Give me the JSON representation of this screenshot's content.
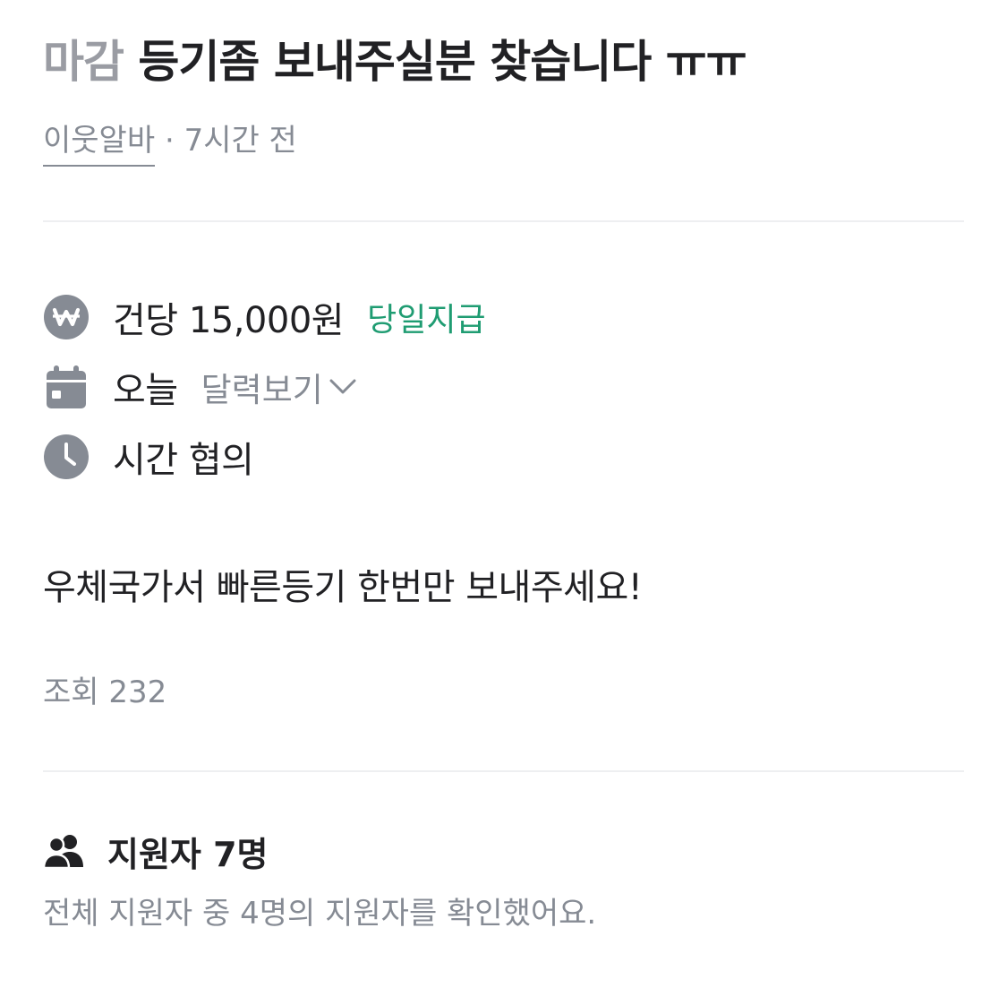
{
  "post": {
    "status": "마감",
    "title": "등기좀 보내주실분 찾습니다 ㅠㅠ",
    "author": "이웃알바",
    "separator": "·",
    "time_ago": "7시간 전"
  },
  "details": {
    "pay": {
      "icon": "won-coin-icon",
      "text": "건당 15,000원",
      "badge": "당일지급"
    },
    "date": {
      "icon": "calendar-icon",
      "text": "오늘",
      "calendar_link": "달력보기"
    },
    "time": {
      "icon": "clock-icon",
      "text": "시간 협의"
    }
  },
  "content": {
    "body": "우체국가서 빠른등기 한번만 보내주세요!",
    "views": "조회 232"
  },
  "applicants": {
    "icon": "people-icon",
    "title": "지원자 7명",
    "summary": "전체 지원자 중 4명의 지원자를 확인했어요."
  },
  "colors": {
    "text_primary": "#212124",
    "text_secondary": "#868b94",
    "icon_gray": "#868b94",
    "accent_green": "#1f9c72",
    "divider": "#eeeff1"
  }
}
